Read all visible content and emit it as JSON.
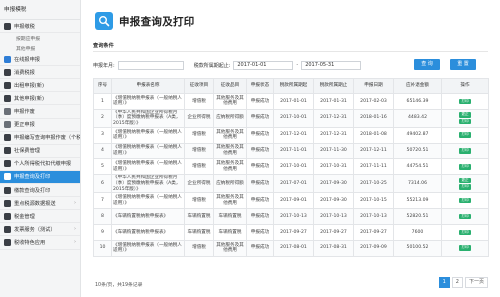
{
  "sidebar": {
    "header": "申报模税",
    "items": [
      {
        "label": "申报缴税",
        "type": "parent",
        "icon": "tax-icon"
      },
      {
        "label": "按期应申报",
        "type": "sub"
      },
      {
        "label": "其他申报",
        "type": "sub"
      },
      {
        "label": "在线报申报",
        "type": "item",
        "icon": "shield-icon"
      },
      {
        "label": "消费税报",
        "type": "item",
        "icon": "document-icon"
      },
      {
        "label": "出租申报(新)",
        "type": "item",
        "icon": "document-icon"
      },
      {
        "label": "其他申报(新)",
        "type": "item",
        "icon": "document-icon"
      },
      {
        "label": "申报作废",
        "type": "item",
        "icon": "cancel-icon"
      },
      {
        "label": "更正申报",
        "type": "item",
        "icon": "edit-icon"
      },
      {
        "label": "申报编写查询申报作废（个税）",
        "type": "item",
        "icon": "list-icon"
      },
      {
        "label": "社保费管理",
        "type": "item",
        "icon": "gear-icon"
      },
      {
        "label": "个人所得税代扣代缴申报",
        "type": "item",
        "icon": "person-icon"
      },
      {
        "label": "申报查询及打印",
        "type": "active",
        "icon": "print-icon"
      },
      {
        "label": "缴款查询及打印",
        "type": "item",
        "icon": "print-icon"
      },
      {
        "label": "重点税源数据报送",
        "type": "item",
        "icon": "chart-icon"
      },
      {
        "label": "税金管理",
        "type": "item",
        "icon": "gear-icon"
      },
      {
        "label": "发票服务（测试）",
        "type": "item",
        "icon": "invoice-icon"
      },
      {
        "label": "税收特色应用",
        "type": "item",
        "icon": "app-icon"
      }
    ]
  },
  "page": {
    "title": "申报查询及打印",
    "section": "查询条件",
    "form": {
      "name_label": "申报年月:",
      "name_value": "",
      "period_label": "税款所属期起止:",
      "date_from": "2017-01-01",
      "date_to": "2017-05-31",
      "query_btn": "查 询",
      "reset_btn": "重 置"
    }
  },
  "table": {
    "headers": [
      "序号",
      "申报表名称",
      "征收项目",
      "征收品目",
      "申报状态",
      "税款所属期起",
      "税款所属期止",
      "申报日期",
      "应补退金额",
      "操作"
    ],
    "rows": [
      [
        "1",
        "《增值税纳税申报表（一般纳税人适用）》",
        "增值税",
        "其他服务及其他费用",
        "申报成功",
        "2017-01-01",
        "2017-01-31",
        "2017-02-03",
        "65146.39",
        [
          "打印"
        ]
      ],
      [
        "2",
        "《中华人民共和国企业所得税月（季）度预缴纳税申报表（A类，2015年版）》",
        "企业所得税",
        "应纳税所得额",
        "申报成功",
        "2017-10-01",
        "2017-12-31",
        "2018-01-16",
        "4483.42",
        [
          "更正",
          "打印"
        ]
      ],
      [
        "3",
        "《增值税纳税申报表（一般纳税人适用）》",
        "增值税",
        "其他服务及其他费用",
        "申报成功",
        "2017-12-01",
        "2017-12-31",
        "2018-01-08",
        "49402.87",
        [
          "打印"
        ]
      ],
      [
        "4",
        "《增值税纳税申报表（一般纳税人适用）》",
        "增值税",
        "其他服务及其他费用",
        "申报成功",
        "2017-11-01",
        "2017-11-30",
        "2017-12-11",
        "50720.51",
        [
          "打印"
        ]
      ],
      [
        "5",
        "《增值税纳税申报表（一般纳税人适用）》",
        "增值税",
        "其他服务及其他费用",
        "申报成功",
        "2017-10-01",
        "2017-10-31",
        "2017-11-11",
        "44754.51",
        [
          "打印"
        ]
      ],
      [
        "6",
        "《中华人民共和国企业所得税月（季）度预缴纳税申报表（A类，2015年版）》",
        "企业所得税",
        "应纳税所得额",
        "申报成功",
        "2017-07-01",
        "2017-09-30",
        "2017-10-25",
        "7314.06",
        [
          "更正",
          "打印"
        ]
      ],
      [
        "7",
        "《增值税纳税申报表（一般纳税人适用）》",
        "增值税",
        "其他服务及其他费用",
        "申报成功",
        "2017-09-01",
        "2017-09-30",
        "2017-10-15",
        "55213.09",
        [
          "打印"
        ]
      ],
      [
        "8",
        "《车辆购置税纳税申报表》",
        "车辆购置税",
        "车辆购置税",
        "申报成功",
        "2017-10-13",
        "2017-10-13",
        "2017-10-13",
        "52820.51",
        [
          "打印"
        ]
      ],
      [
        "9",
        "《车辆购置税纳税申报表》",
        "车辆购置税",
        "车辆购置税",
        "申报成功",
        "2017-09-27",
        "2017-09-27",
        "2017-09-27",
        "7600",
        [
          "打印"
        ]
      ],
      [
        "10",
        "《增值税纳税申报表（一般纳税人适用）》",
        "增值税",
        "其他服务及其他费用",
        "申报成功",
        "2017-08-01",
        "2017-08-31",
        "2017-09-09",
        "50100.52",
        [
          "打印"
        ]
      ]
    ]
  },
  "footer": {
    "summary": "10条/页，共19条记录",
    "pages": [
      "1",
      "2",
      "下一页"
    ]
  },
  "colors": {
    "accent": "#2b8edc",
    "op_button": "#2ab06f",
    "sidebar_bg": "#f4f5f6"
  }
}
